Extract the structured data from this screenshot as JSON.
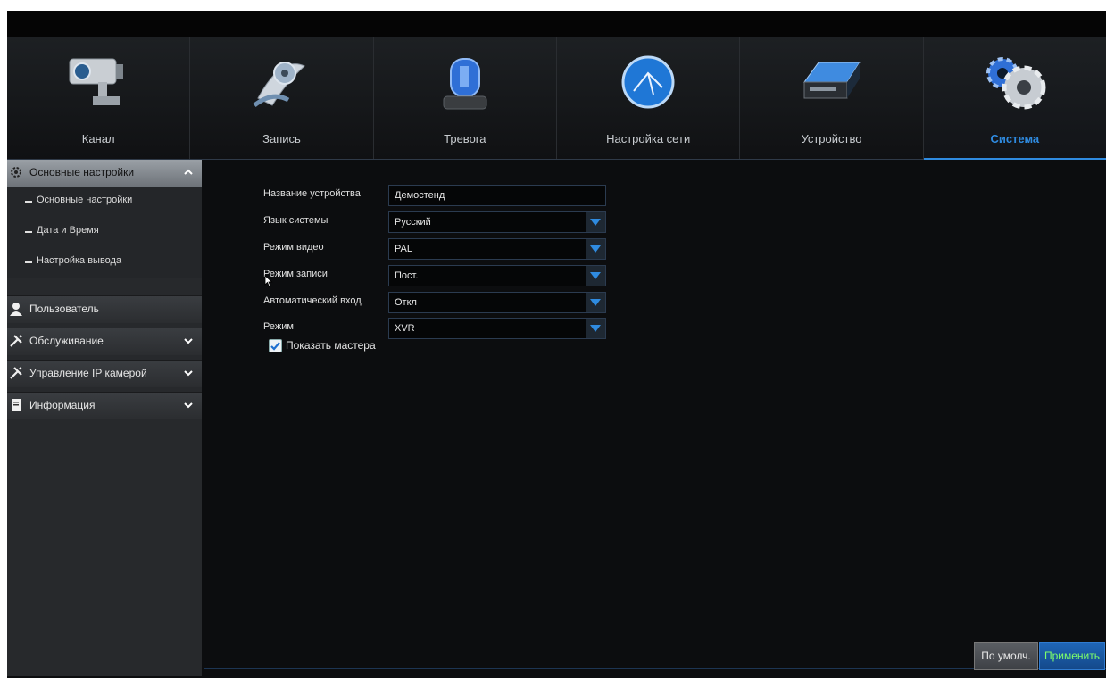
{
  "tabs": [
    {
      "label": "Канал",
      "icon": "camera-icon"
    },
    {
      "label": "Запись",
      "icon": "film-reel-icon"
    },
    {
      "label": "Тревога",
      "icon": "alarm-siren-icon"
    },
    {
      "label": "Настройка сети",
      "icon": "network-globe-icon"
    },
    {
      "label": "Устройство",
      "icon": "hard-drive-icon"
    },
    {
      "label": "Система",
      "icon": "gears-icon",
      "active": true
    }
  ],
  "sidebar": {
    "sections": [
      {
        "label": "Основные настройки",
        "icon": "gear-icon",
        "expanded": true
      },
      {
        "label": "Пользователь",
        "icon": "user-icon"
      },
      {
        "label": "Обслуживание",
        "icon": "tools-icon"
      },
      {
        "label": "Управление IP камерой",
        "icon": "tools-icon"
      },
      {
        "label": "Информация",
        "icon": "info-icon"
      }
    ],
    "subitems": [
      "Основные настройки",
      "Дата и Время",
      "Настройка вывода"
    ]
  },
  "form": {
    "device_name": {
      "label": "Название устройства",
      "value": "Демостенд"
    },
    "language": {
      "label": "Язык системы",
      "value": "Русский"
    },
    "video_mode": {
      "label": "Режим видео",
      "value": "PAL"
    },
    "record_mode": {
      "label": "Режим записи",
      "value": "Пост."
    },
    "auto_login": {
      "label": "Автоматический вход",
      "value": "Откл"
    },
    "mode": {
      "label": "Режим",
      "value": "XVR"
    },
    "show_wizard": {
      "label": "Показать мастера",
      "checked": true
    }
  },
  "buttons": {
    "default": "По умолч.",
    "apply": "Применить"
  },
  "colors": {
    "accent": "#2f8be0",
    "apply_text": "#7dff6a",
    "background": "#0c0d0f"
  }
}
